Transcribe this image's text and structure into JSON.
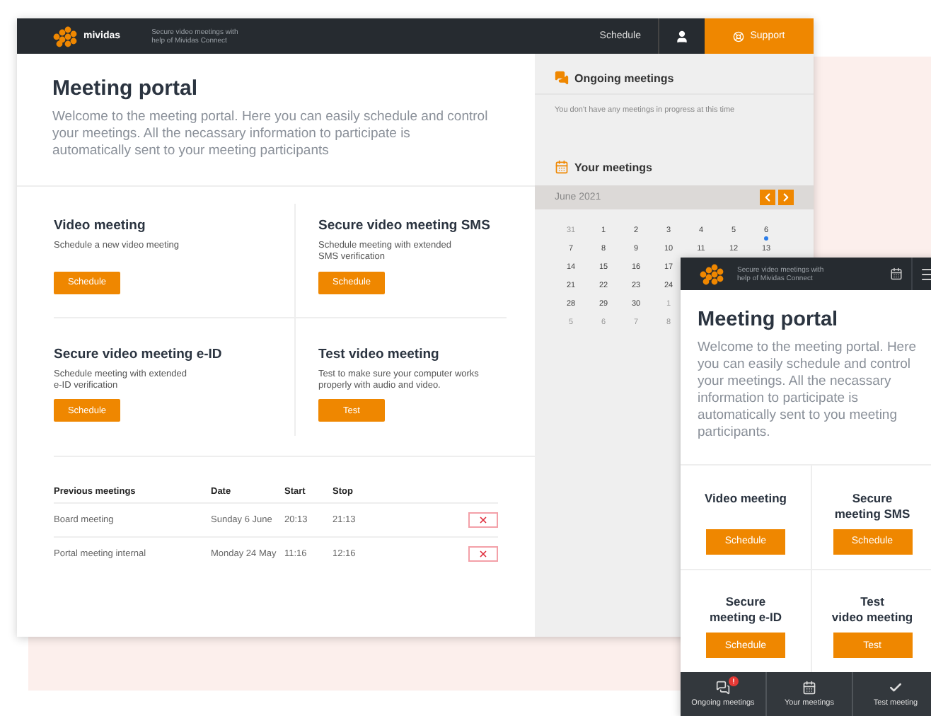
{
  "desktop": {
    "header": {
      "logo": "mividas",
      "tagline": "Secure video meetings with help of Mividas Connect",
      "nav": [
        "Schedule"
      ],
      "support": "Support"
    },
    "intro": {
      "title": "Meeting portal",
      "description": "Welcome to the meeting portal. Here you can easily schedule and control your meetings. All the necassary information to participate is automatically sent to your meeting participants"
    },
    "services": [
      {
        "title": "Video meeting",
        "description": "Schedule a new video meeting",
        "button": "Schedule"
      },
      {
        "title": "Secure video meeting SMS",
        "description": "Schedule meeting with extended\nSMS verification",
        "button": "Schedule"
      },
      {
        "title": "Secure video meeting e-ID",
        "description": "Schedule meeting with extended\ne-ID verification",
        "button": "Schedule"
      },
      {
        "title": "Test video meeting",
        "description": "Test to make sure your computer works\nproperly with audio and video.",
        "button": "Test"
      }
    ],
    "previous_meetings": {
      "columns": [
        "Previous meetings",
        "Date",
        "Start",
        "Stop"
      ],
      "rows": [
        {
          "cells": [
            "Board meeting",
            "Sunday 6 June",
            "20:13",
            "21:13"
          ]
        },
        {
          "cells": [
            "Portal meeting internal",
            "Monday 24 May",
            "11:16",
            "12:16"
          ]
        }
      ]
    },
    "sidebar": {
      "ongoing": {
        "title": "Ongoing meetings",
        "empty": "You don't have any meetings in progress at this time"
      },
      "your_meetings": {
        "title": "Your meetings"
      },
      "calendar": {
        "month": "June 2021",
        "weeks": [
          [
            {
              "day": "31",
              "outside": true
            },
            {
              "day": "1",
              "outside": false
            },
            {
              "day": "2",
              "outside": false
            },
            {
              "day": "3",
              "outside": false
            },
            {
              "day": "4",
              "outside": false
            },
            {
              "day": "5",
              "outside": false
            },
            {
              "day": "6",
              "outside": false,
              "has_meeting": true
            }
          ],
          [
            {
              "day": "7",
              "outside": false
            },
            {
              "day": "8",
              "outside": false
            },
            {
              "day": "9",
              "outside": false
            },
            {
              "day": "10",
              "outside": false
            },
            {
              "day": "11",
              "outside": false
            },
            {
              "day": "12",
              "outside": false
            },
            {
              "day": "13",
              "outside": false
            }
          ],
          [
            {
              "day": "14",
              "outside": false
            },
            {
              "day": "15",
              "outside": false
            },
            {
              "day": "16",
              "outside": false
            },
            {
              "day": "17",
              "outside": false
            }
          ],
          [
            {
              "day": "21",
              "outside": false
            },
            {
              "day": "22",
              "outside": false
            },
            {
              "day": "23",
              "outside": false
            },
            {
              "day": "24",
              "outside": false
            }
          ],
          [
            {
              "day": "28",
              "outside": false
            },
            {
              "day": "29",
              "outside": false
            },
            {
              "day": "30",
              "outside": false
            },
            {
              "day": "1",
              "outside": true
            }
          ],
          [
            {
              "day": "5",
              "outside": true
            },
            {
              "day": "6",
              "outside": true
            },
            {
              "day": "7",
              "outside": true
            },
            {
              "day": "8",
              "outside": true
            }
          ]
        ]
      }
    }
  },
  "mobile": {
    "header": {
      "tagline": "Secure video meetings with help of Mividas Connect"
    },
    "intro": {
      "title": "Meeting portal",
      "description": "Welcome to the meeting portal. Here you can easily schedule and control your meetings. All the necassary information to participate is automatically sent to you meeting participants."
    },
    "services": [
      {
        "title": "Video meeting",
        "button": "Schedule"
      },
      {
        "title": "Secure\nmeeting SMS",
        "button": "Schedule"
      },
      {
        "title": "Secure\nmeeting e-ID",
        "button": "Schedule"
      },
      {
        "title": "Test\nvideo meeting",
        "button": "Test"
      }
    ],
    "bottom_nav": [
      {
        "kind": "chat",
        "label": "Ongoing meetings",
        "badge": "!"
      },
      {
        "kind": "calendar",
        "label": "Your meetings"
      },
      {
        "kind": "check",
        "label": "Test meeting"
      }
    ]
  }
}
